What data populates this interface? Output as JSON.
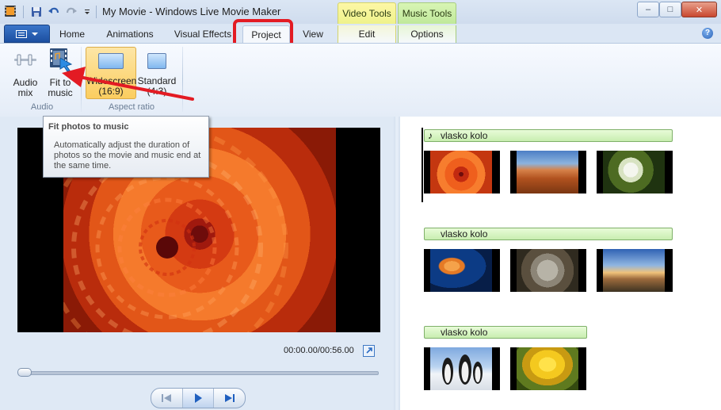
{
  "window": {
    "title": "My Movie - Windows Live Movie Maker",
    "context_tabs": {
      "video_tools": "Video Tools",
      "music_tools": "Music Tools"
    },
    "controls": {
      "minimize": "–",
      "maximize": "□",
      "close": "✕"
    }
  },
  "tabs": [
    {
      "label": "Home"
    },
    {
      "label": "Animations"
    },
    {
      "label": "Visual Effects"
    },
    {
      "label": "Project",
      "active": true
    },
    {
      "label": "View"
    },
    {
      "label": "Edit"
    },
    {
      "label": "Options"
    }
  ],
  "ribbon": {
    "audio_group": {
      "label": "Audio",
      "audio_mix": "Audio mix",
      "fit_to_music": "Fit to music"
    },
    "aspect_group": {
      "label": "Aspect ratio",
      "widescreen": "Widescreen (16:9)",
      "standard": "Standard (4:3)"
    }
  },
  "tooltip": {
    "title": "Fit photos to music",
    "body": "Automatically adjust the duration of photos so the movie and music end at the same time."
  },
  "preview": {
    "time": "00:00.00/00:56.00",
    "seek_progress": 0
  },
  "storyboard": {
    "rows": [
      {
        "music_label": "vlasko kolo",
        "thumbs": [
          "chrysanthemum",
          "desert",
          "hydrangeas"
        ]
      },
      {
        "music_label": "vlasko kolo",
        "thumbs": [
          "jellyfish",
          "koala",
          "lighthouse"
        ]
      },
      {
        "music_label": "vlasko kolo",
        "thumbs": [
          "penguins",
          "tulips"
        ]
      }
    ]
  },
  "colors": {
    "annotation_red": "#e31b23",
    "music_bar": "#c8eeb0",
    "selected_button": "#fbcd5f"
  }
}
